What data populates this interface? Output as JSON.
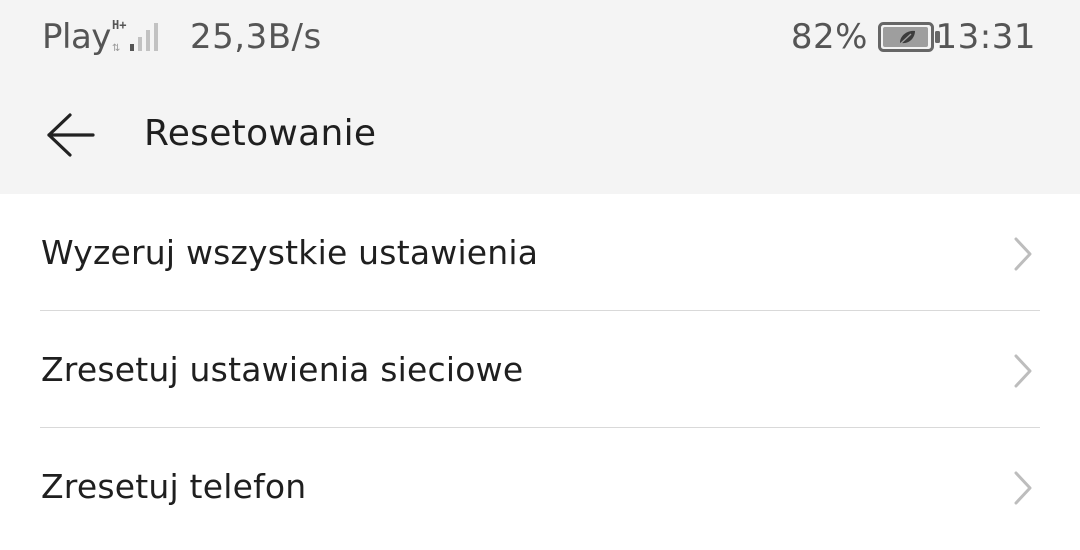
{
  "status_bar": {
    "carrier": "Play",
    "network_type": "H+",
    "net_speed": "25,3B/s",
    "battery_percent": "82%",
    "time": "13:31"
  },
  "app_bar": {
    "title": "Resetowanie",
    "back_icon": "arrow-left-icon"
  },
  "list": {
    "items": [
      {
        "label": "Wyzeruj wszystkie ustawienia",
        "icon": "chevron-right-icon"
      },
      {
        "label": "Zresetuj ustawienia sieciowe",
        "icon": "chevron-right-icon"
      },
      {
        "label": "Zresetuj telefon",
        "icon": "chevron-right-icon"
      }
    ]
  },
  "colors": {
    "header_background": "#f4f4f4",
    "list_background": "#ffffff",
    "primary_text": "#1f1f1f",
    "status_text": "#555555",
    "chevron": "#bdbdbd",
    "divider": "#d9d9d9"
  }
}
